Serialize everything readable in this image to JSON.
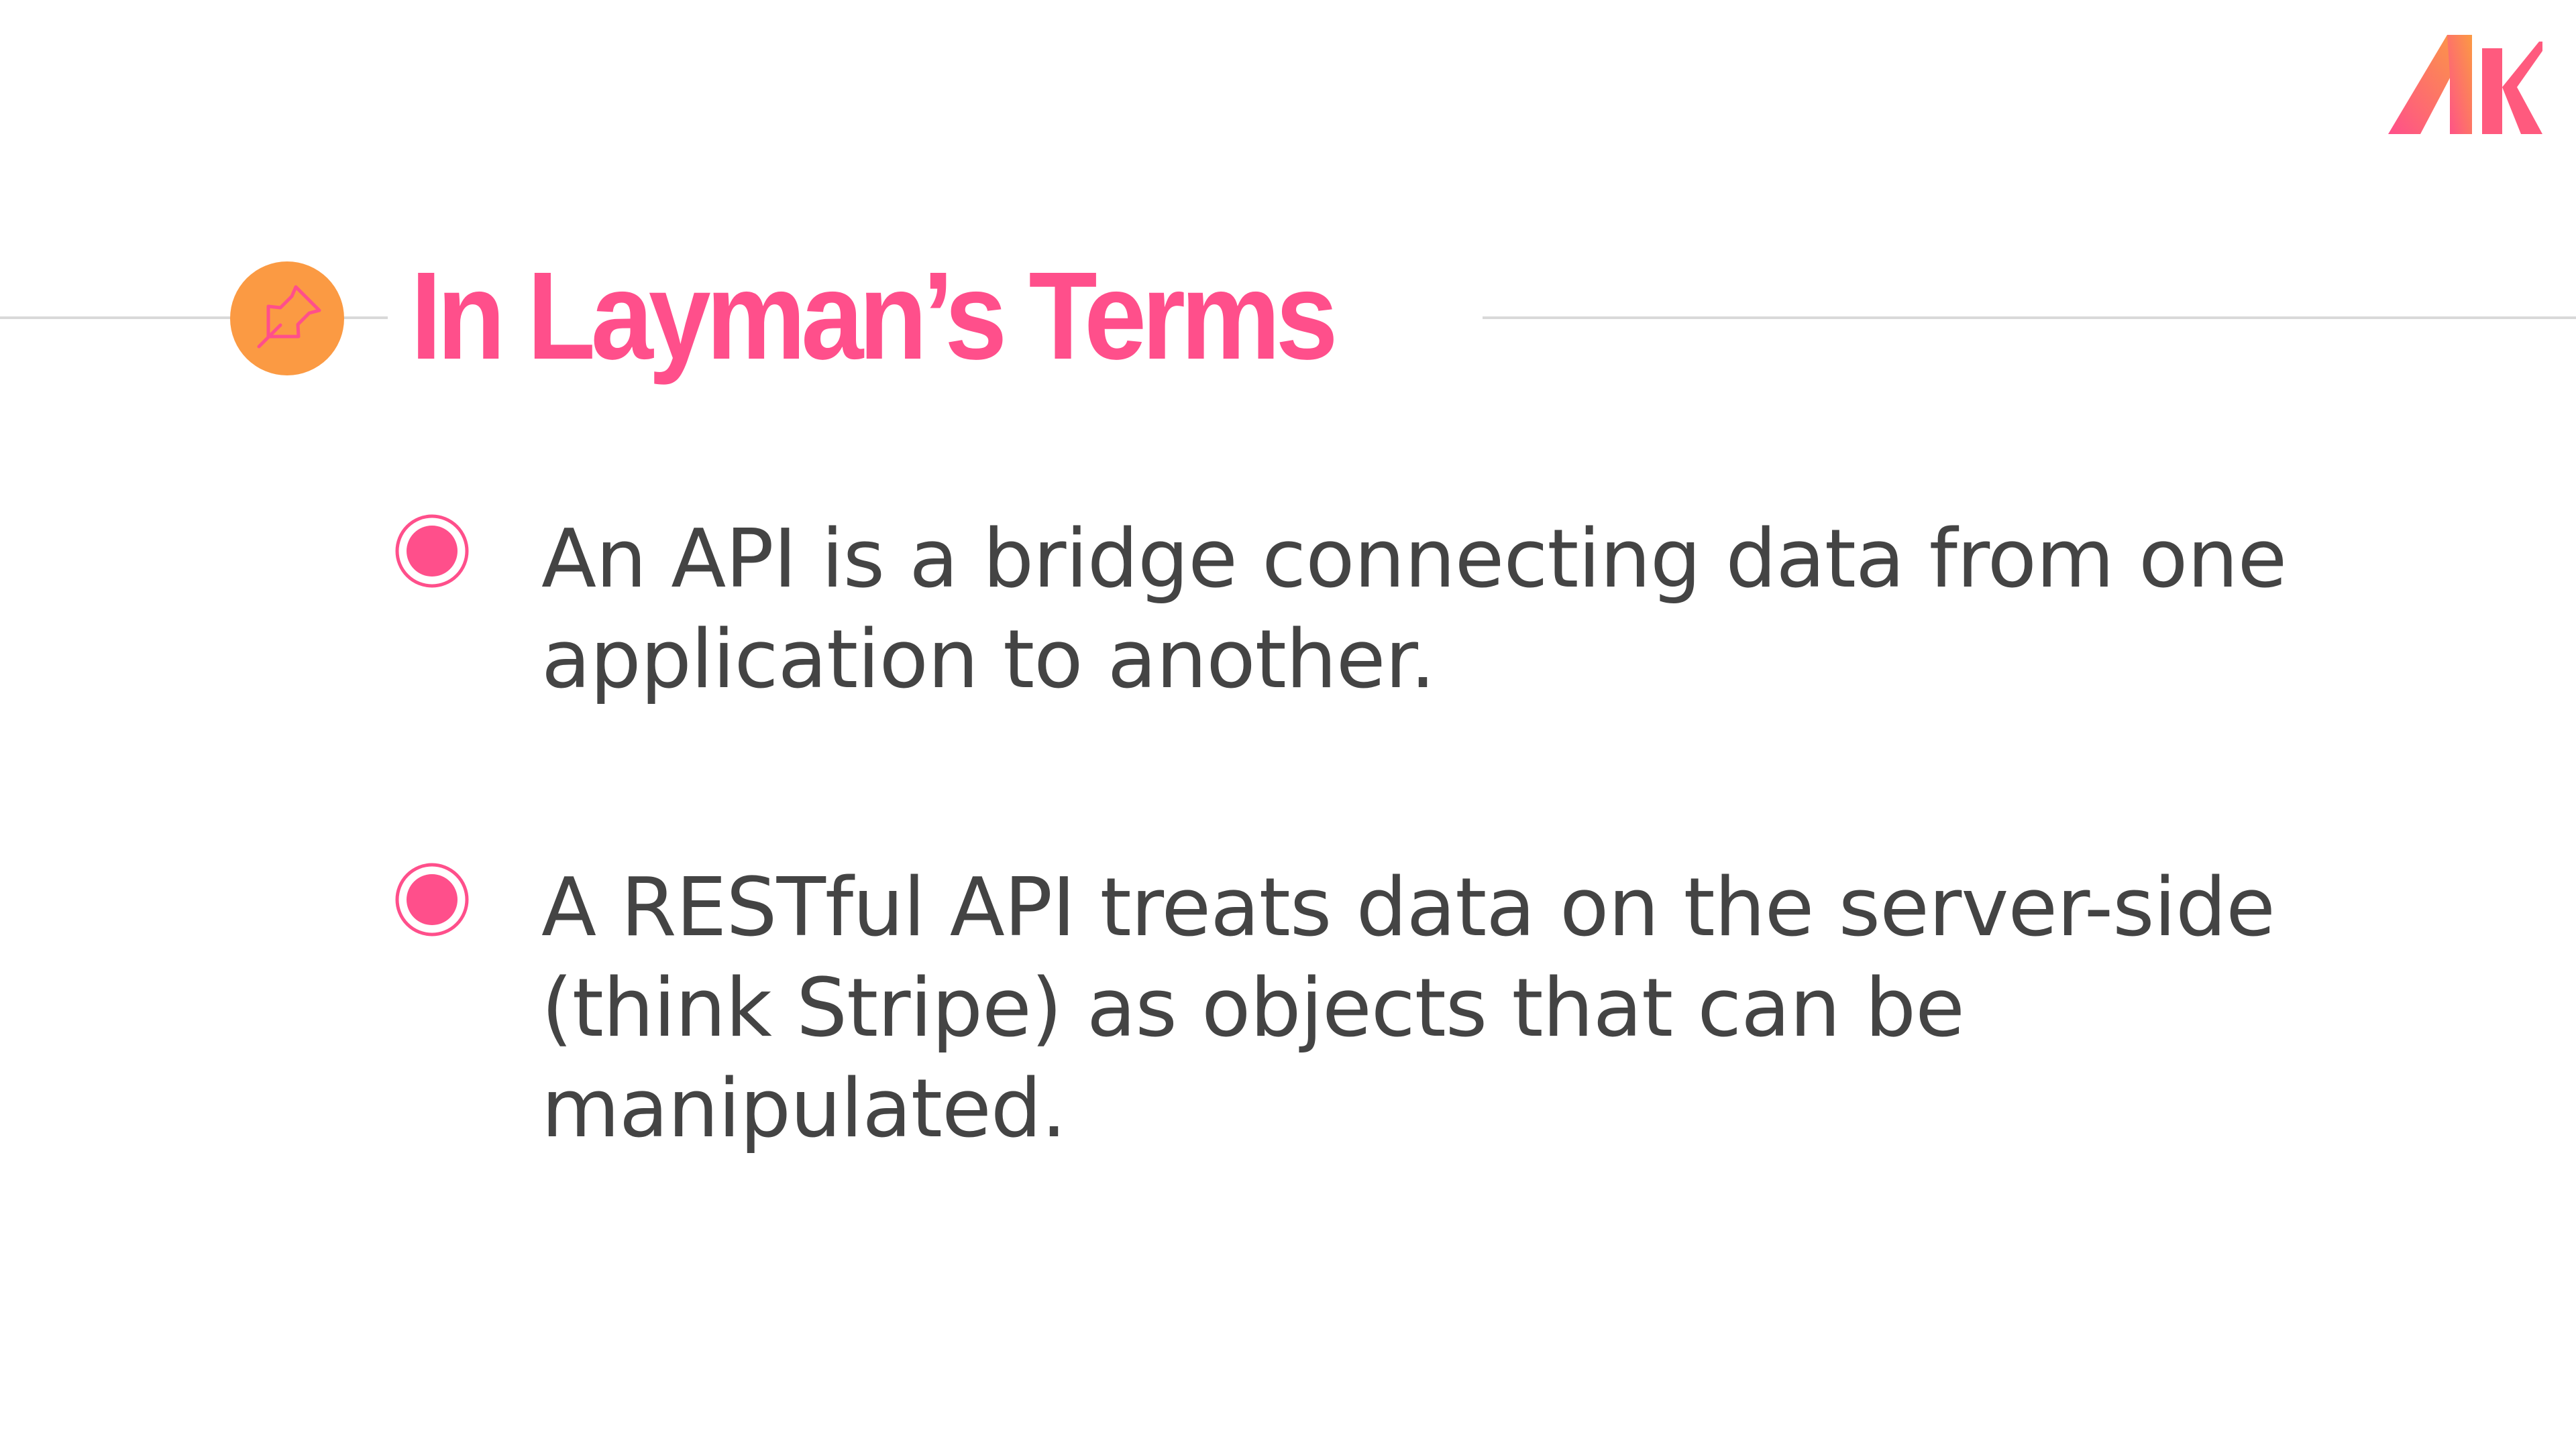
{
  "slide": {
    "title": "In Layman’s Terms",
    "bullets": [
      {
        "text": "An API is a bridge connecting data from one application to another."
      },
      {
        "text": "A RESTful API treats data on the server-side (think Stripe) as objects that can be manipulated."
      }
    ]
  },
  "logo": {
    "text": "AK",
    "colors": [
      "#ff4f8b",
      "#fb9a43"
    ]
  },
  "icons": {
    "title_badge": "pushpin-icon",
    "bullet": "radio-bullet-icon"
  },
  "colors": {
    "accent_pink": "#ff4f8b",
    "accent_orange": "#fb9a43",
    "body_text": "#444444",
    "rule": "#d9d9d9",
    "background": "#ffffff"
  }
}
